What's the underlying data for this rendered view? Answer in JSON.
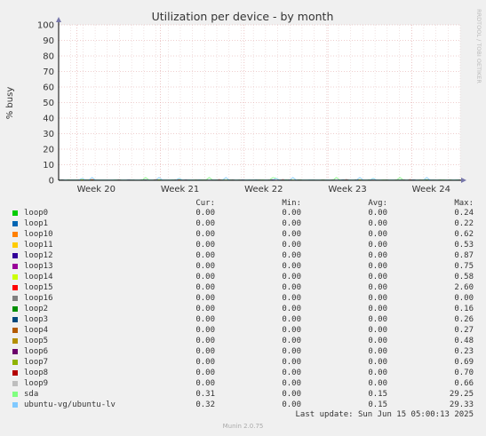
{
  "chart_data": {
    "type": "line",
    "title": "Utilization per device - by month",
    "ylabel": "% busy",
    "watermark": "RRDTOOL / TOBI OETIKER",
    "ylim": [
      0,
      100
    ],
    "yticks": [
      0,
      10,
      20,
      30,
      40,
      50,
      60,
      70,
      80,
      90,
      100
    ],
    "xticks": [
      "Week 20",
      "Week 21",
      "Week 22",
      "Week 23",
      "Week 24"
    ],
    "grid": true,
    "colors": {
      "background": "#f0f0f0",
      "plot": "#ffffff",
      "grid_major": "#e0a0a0",
      "grid_minor": "#e8d0d0",
      "axis": "#000000"
    },
    "columns": [
      "Cur:",
      "Min:",
      "Avg:",
      "Max:"
    ],
    "series": [
      {
        "name": "loop0",
        "color": "#00cc00",
        "cur": "0.00",
        "min": "0.00",
        "avg": "0.00",
        "max": "0.24"
      },
      {
        "name": "loop1",
        "color": "#0066b3",
        "cur": "0.00",
        "min": "0.00",
        "avg": "0.00",
        "max": "0.22"
      },
      {
        "name": "loop10",
        "color": "#ff8000",
        "cur": "0.00",
        "min": "0.00",
        "avg": "0.00",
        "max": "0.62"
      },
      {
        "name": "loop11",
        "color": "#ffcc00",
        "cur": "0.00",
        "min": "0.00",
        "avg": "0.00",
        "max": "0.53"
      },
      {
        "name": "loop12",
        "color": "#330099",
        "cur": "0.00",
        "min": "0.00",
        "avg": "0.00",
        "max": "0.87"
      },
      {
        "name": "loop13",
        "color": "#990099",
        "cur": "0.00",
        "min": "0.00",
        "avg": "0.00",
        "max": "0.75"
      },
      {
        "name": "loop14",
        "color": "#ccff00",
        "cur": "0.00",
        "min": "0.00",
        "avg": "0.00",
        "max": "0.58"
      },
      {
        "name": "loop15",
        "color": "#ff0000",
        "cur": "0.00",
        "min": "0.00",
        "avg": "0.00",
        "max": "2.60"
      },
      {
        "name": "loop16",
        "color": "#808080",
        "cur": "0.00",
        "min": "0.00",
        "avg": "0.00",
        "max": "0.00"
      },
      {
        "name": "loop2",
        "color": "#008f00",
        "cur": "0.00",
        "min": "0.00",
        "avg": "0.00",
        "max": "0.16"
      },
      {
        "name": "loop3",
        "color": "#00487d",
        "cur": "0.00",
        "min": "0.00",
        "avg": "0.00",
        "max": "0.26"
      },
      {
        "name": "loop4",
        "color": "#b35a00",
        "cur": "0.00",
        "min": "0.00",
        "avg": "0.00",
        "max": "0.27"
      },
      {
        "name": "loop5",
        "color": "#b38f00",
        "cur": "0.00",
        "min": "0.00",
        "avg": "0.00",
        "max": "0.48"
      },
      {
        "name": "loop6",
        "color": "#6b006b",
        "cur": "0.00",
        "min": "0.00",
        "avg": "0.00",
        "max": "0.23"
      },
      {
        "name": "loop7",
        "color": "#8fb300",
        "cur": "0.00",
        "min": "0.00",
        "avg": "0.00",
        "max": "0.69"
      },
      {
        "name": "loop8",
        "color": "#b30000",
        "cur": "0.00",
        "min": "0.00",
        "avg": "0.00",
        "max": "0.70"
      },
      {
        "name": "loop9",
        "color": "#bebebe",
        "cur": "0.00",
        "min": "0.00",
        "avg": "0.00",
        "max": "0.66"
      },
      {
        "name": "sda",
        "color": "#80ff80",
        "cur": "0.31",
        "min": "0.00",
        "avg": "0.15",
        "max": "29.25"
      },
      {
        "name": "ubuntu-vg/ubuntu-lv",
        "color": "#80c9ff",
        "cur": "0.32",
        "min": "0.00",
        "avg": "0.15",
        "max": "29.33"
      }
    ]
  },
  "footer": {
    "last_update": "Last update: Sun Jun 15 05:00:13 2025",
    "version": "Munin 2.0.75"
  }
}
